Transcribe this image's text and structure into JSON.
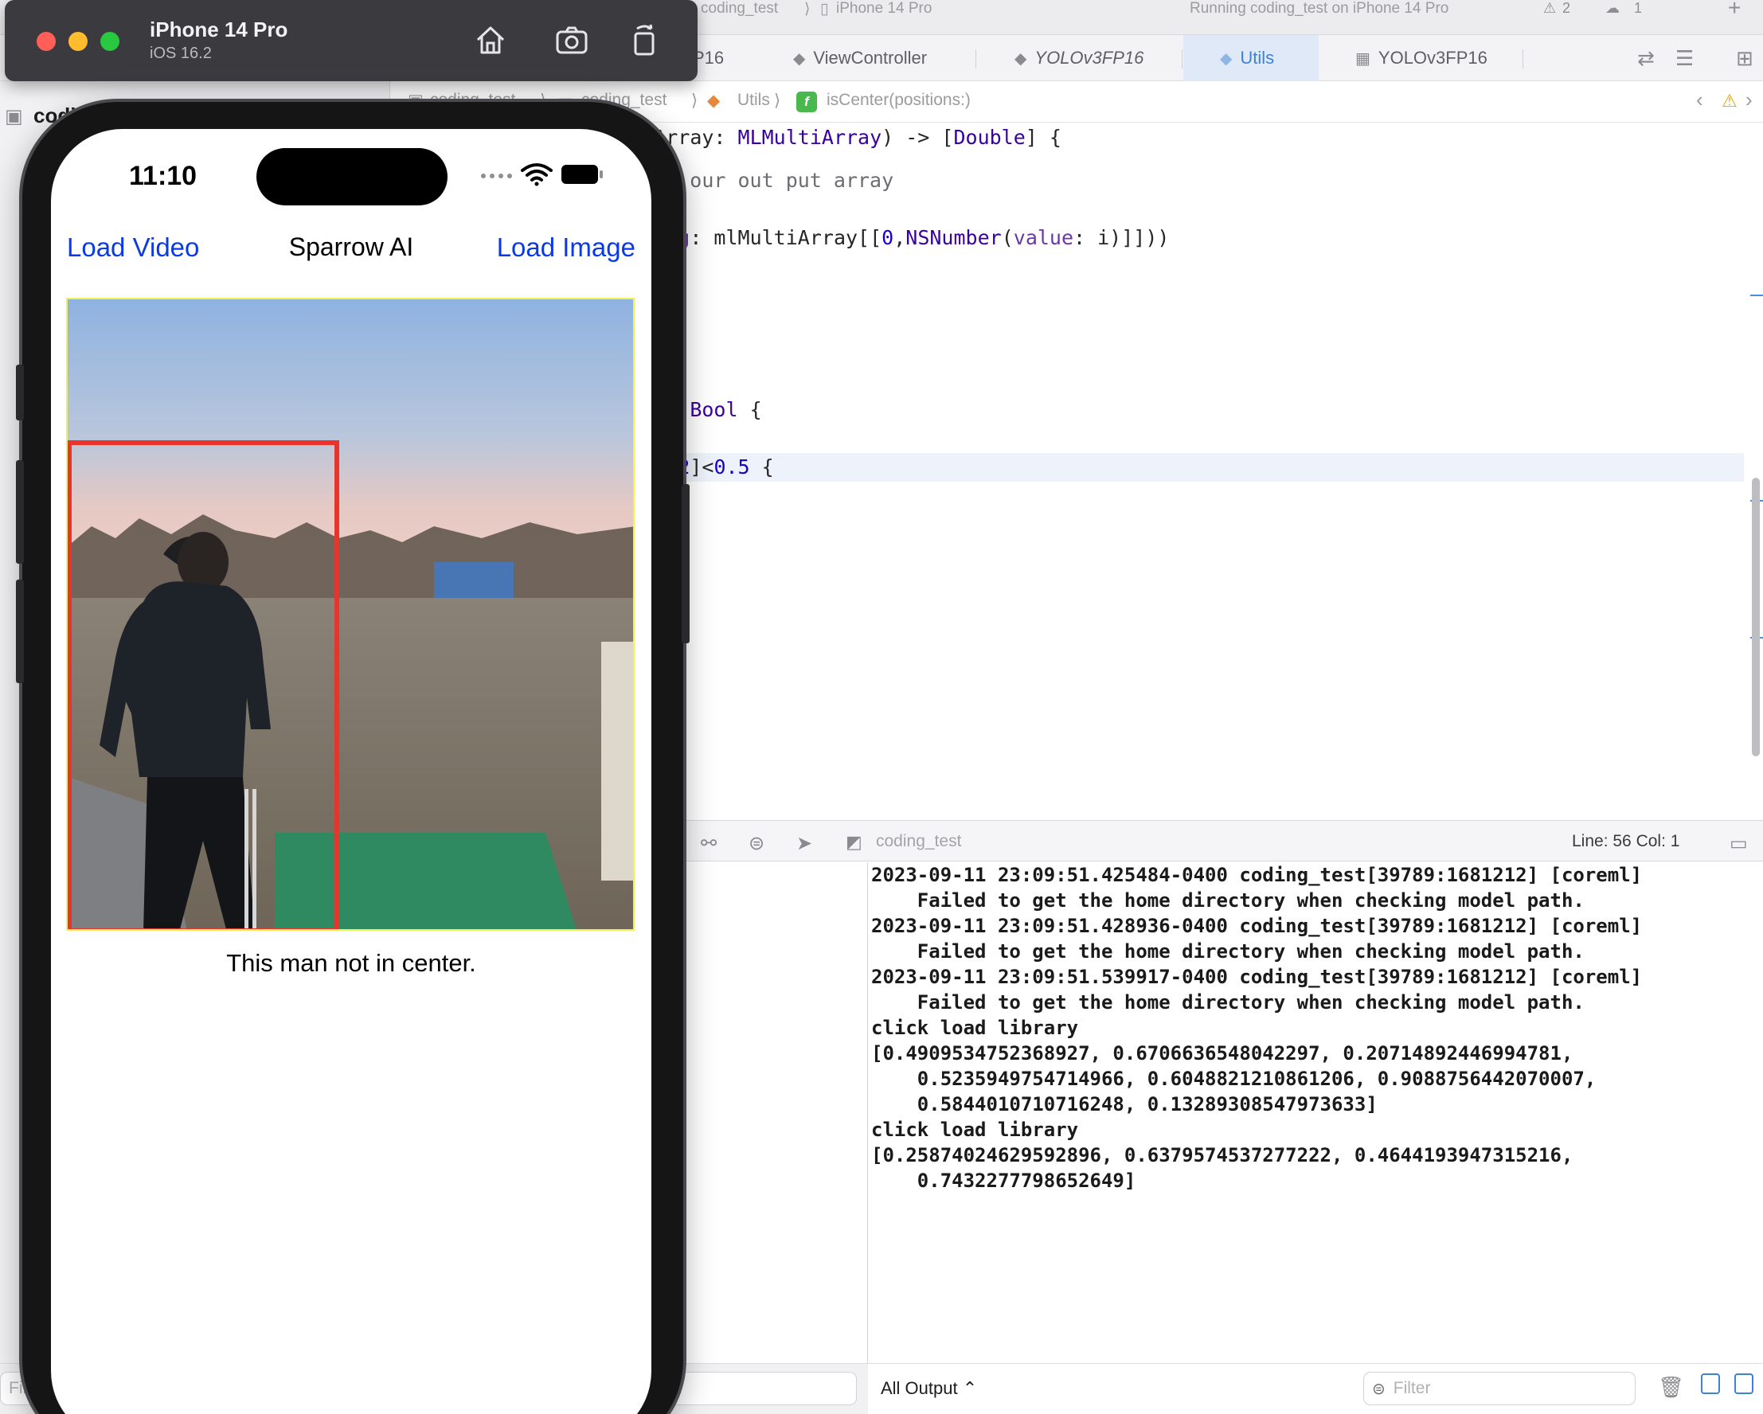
{
  "xcode": {
    "titlebar": {
      "scheme": "coding_test",
      "destination": "iPhone 14 Pro",
      "status": "Running coding_test on iPhone 14 Pro",
      "warnings": "2",
      "issues": "1"
    },
    "tabs": [
      {
        "label": "P16"
      },
      {
        "label": "ViewController"
      },
      {
        "label": "YOLOv3FP16"
      },
      {
        "label": "Utils"
      },
      {
        "label": "YOLOv3FP16"
      }
    ],
    "jumpbar": {
      "project": "coding_test",
      "group": "coding_test",
      "file": "Utils",
      "symbol": "isCenter(positions:)"
    },
    "sidebar": {
      "project_label": "codin"
    },
    "debugbar": {
      "target": "coding_test",
      "cursor": "Line: 56  Col: 1"
    },
    "console": {
      "lines": [
        "2023-09-11 23:09:51.425484-0400 coding_test[39789:1681212] [coreml]",
        "    Failed to get the home directory when checking model path.",
        "2023-09-11 23:09:51.428936-0400 coding_test[39789:1681212] [coreml]",
        "    Failed to get the home directory when checking model path.",
        "2023-09-11 23:09:51.539917-0400 coding_test[39789:1681212] [coreml]",
        "    Failed to get the home directory when checking model path.",
        "click load library",
        "[0.4909534752368927, 0.6706636548042297, 0.20714892446994781,",
        "    0.5235949754714966, 0.6048821210861206, 0.9088756442070007,",
        "    0.5844010710716248, 0.13289308547973633]",
        "click load library",
        "[0.25874024629592896, 0.6379574537277222, 0.4644193947315216,",
        "    0.7432277798652649]"
      ],
      "output_selector": "All Output ⌃",
      "filter_placeholder": "Filter",
      "left_filter_placeholder": "Filt"
    }
  },
  "simulator": {
    "device_name": "iPhone 14 Pro",
    "os_version": "iOS 16.2",
    "status_time": "11:10",
    "app": {
      "left_button": "Load Video",
      "title": "Sparrow AI",
      "right_button": "Load Image",
      "result_text": "This man not in center."
    }
  },
  "colors": {
    "link_blue": "#0a3ae8",
    "detection_box": "#e8342a",
    "image_border": "#f0f05a",
    "active_tab": "#3d82d6"
  }
}
